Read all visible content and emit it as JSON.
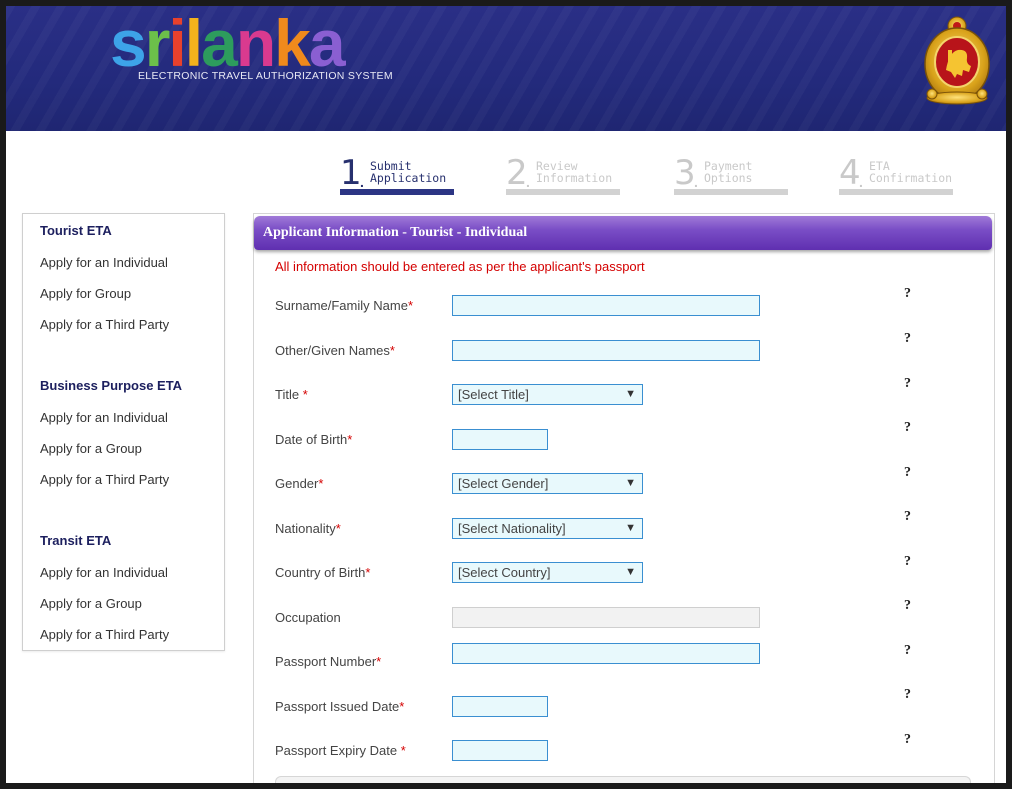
{
  "header": {
    "logo_letters": [
      {
        "ch": "s",
        "color": "#3da3e8"
      },
      {
        "ch": "r",
        "color": "#6cc04a"
      },
      {
        "ch": "i",
        "color": "#e8412c"
      },
      {
        "ch": "l",
        "color": "#f3b21c"
      },
      {
        "ch": "a",
        "color": "#2d9c5d"
      },
      {
        "ch": "n",
        "color": "#d93a8f"
      },
      {
        "ch": "k",
        "color": "#f08a1c"
      },
      {
        "ch": "a",
        "color": "#8a5fd2"
      }
    ],
    "subtitle": "ELECTRONIC TRAVEL AUTHORIZATION SYSTEM",
    "emblem_icon": "sri-lanka-emblem-icon"
  },
  "steps": [
    {
      "num": "1",
      "line1": "Submit",
      "line2": "Application",
      "state": "active"
    },
    {
      "num": "2",
      "line1": "Review",
      "line2": "Information",
      "state": "inactive"
    },
    {
      "num": "3",
      "line1": "Payment",
      "line2": "Options",
      "state": "inactive"
    },
    {
      "num": "4",
      "line1": "ETA",
      "line2": "Confirmation",
      "state": "inactive"
    }
  ],
  "sidebar": {
    "groups": [
      {
        "title": "Tourist ETA",
        "links": [
          "Apply for an Individual",
          "Apply for Group",
          "Apply for a Third Party"
        ]
      },
      {
        "title": "Business Purpose ETA",
        "links": [
          "Apply for an Individual",
          "Apply for a Group",
          "Apply for a Third Party"
        ]
      },
      {
        "title": "Transit ETA",
        "links": [
          "Apply for an Individual",
          "Apply for a Group",
          "Apply for a Third Party"
        ]
      }
    ]
  },
  "form": {
    "title": "Applicant Information - Tourist - Individual",
    "note": "All information should be entered as per the applicant's passport",
    "required_mark": "*",
    "help_mark": "?",
    "fields": {
      "surname": {
        "label": "Surname/Family Name",
        "value": ""
      },
      "given": {
        "label": "Other/Given Names",
        "value": ""
      },
      "title": {
        "label": "Title ",
        "value": "[Select Title]"
      },
      "dob": {
        "label": "Date of Birth",
        "value": ""
      },
      "gender": {
        "label": "Gender",
        "value": "[Select Gender]"
      },
      "nationality": {
        "label": "Nationality",
        "value": "[Select Nationality]"
      },
      "cob": {
        "label": "Country of Birth",
        "value": "[Select Country]"
      },
      "occupation": {
        "label": "Occupation",
        "value": ""
      },
      "passport_no": {
        "label": "Passport Number",
        "value": ""
      },
      "issued": {
        "label": "Passport Issued Date",
        "value": ""
      },
      "expiry": {
        "label": "Passport Expiry Date ",
        "value": ""
      }
    },
    "select_arrow": "▼"
  }
}
